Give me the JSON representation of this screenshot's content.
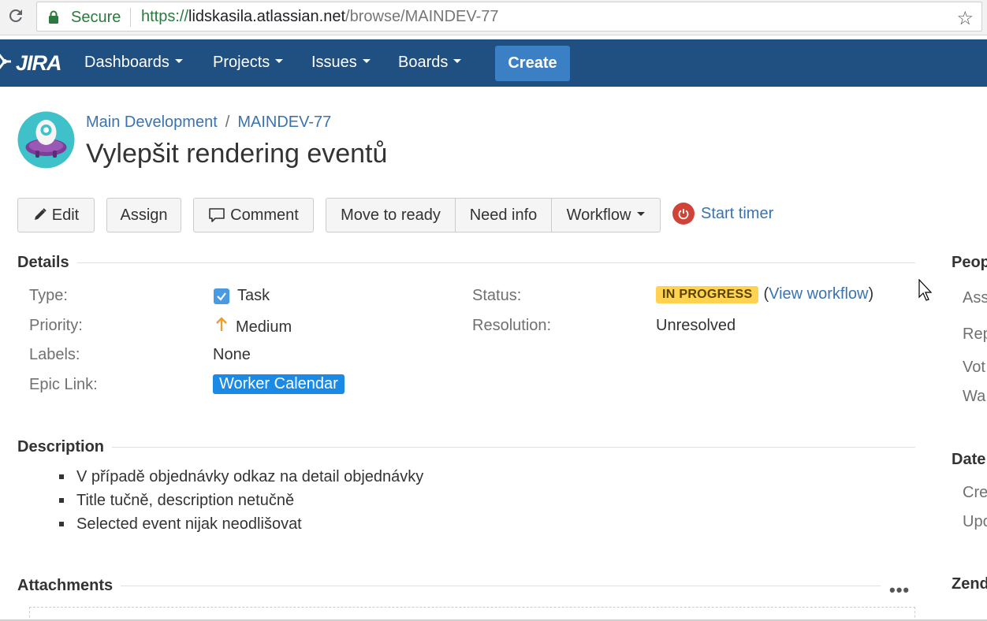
{
  "browser": {
    "secure_label": "Secure",
    "url_protocol": "https://",
    "url_host": "lidskasila.atlassian.net",
    "url_path": "/browse/MAINDEV-77"
  },
  "nav": {
    "logo": "JIRA",
    "dashboards": "Dashboards",
    "projects": "Projects",
    "issues": "Issues",
    "boards": "Boards",
    "create": "Create"
  },
  "issue": {
    "project": "Main Development",
    "key": "MAINDEV-77",
    "summary": "Vylepšit rendering eventů"
  },
  "toolbar": {
    "edit": "Edit",
    "assign": "Assign",
    "comment": "Comment",
    "move_to_ready": "Move to ready",
    "need_info": "Need info",
    "workflow": "Workflow",
    "start_timer": "Start timer"
  },
  "details": {
    "heading": "Details",
    "type_label": "Type:",
    "type_value": "Task",
    "priority_label": "Priority:",
    "priority_value": "Medium",
    "labels_label": "Labels:",
    "labels_value": "None",
    "epic_label": "Epic Link:",
    "epic_value": "Worker Calendar",
    "status_label": "Status:",
    "status_value": "IN PROGRESS",
    "view_workflow": "View workflow",
    "resolution_label": "Resolution:",
    "resolution_value": "Unresolved"
  },
  "description": {
    "heading": "Description",
    "items": [
      "V případě objednávky odkaz na detail objednávky",
      "Title tučně, description netučně",
      "Selected event nijak neodlišovat"
    ]
  },
  "attachments": {
    "heading": "Attachments"
  },
  "right_panel": {
    "people_heading": "Peop",
    "assignee": "Ass",
    "reporter": "Rep",
    "votes": "Vot",
    "watchers": "Wa",
    "dates_heading": "Date",
    "created": "Cre",
    "updated": "Upc",
    "zendesk_heading": "Zend"
  },
  "colors": {
    "header_bg": "#205081",
    "create_bg": "#3b7fc4",
    "link": "#3b73af",
    "status_yellow": "#ffd351",
    "epic_blue": "#1a8ae6",
    "timer_red": "#d04437"
  }
}
